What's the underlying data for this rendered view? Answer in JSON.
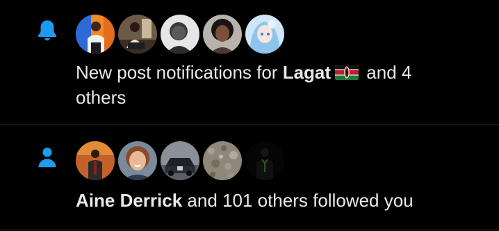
{
  "notifications": [
    {
      "type_icon": "bell-icon",
      "message": {
        "prefix": "New post notifications for ",
        "name": "Lagat",
        "flag": "kenya-flag-emoji",
        "suffix": " and 4 others"
      },
      "avatars": [
        "avatar-1",
        "avatar-2",
        "avatar-3",
        "avatar-4",
        "avatar-5"
      ]
    },
    {
      "type_icon": "person-icon",
      "message": {
        "name": "Aine Derrick",
        "suffix": " and 101 others followed you"
      },
      "avatars": [
        "avatar-1",
        "avatar-2",
        "avatar-3",
        "avatar-4",
        "avatar-5"
      ]
    }
  ],
  "colors": {
    "background": "#000000",
    "text": "#e7e9ea",
    "accent": "#1d9bf0",
    "divider": "#2f3336"
  }
}
